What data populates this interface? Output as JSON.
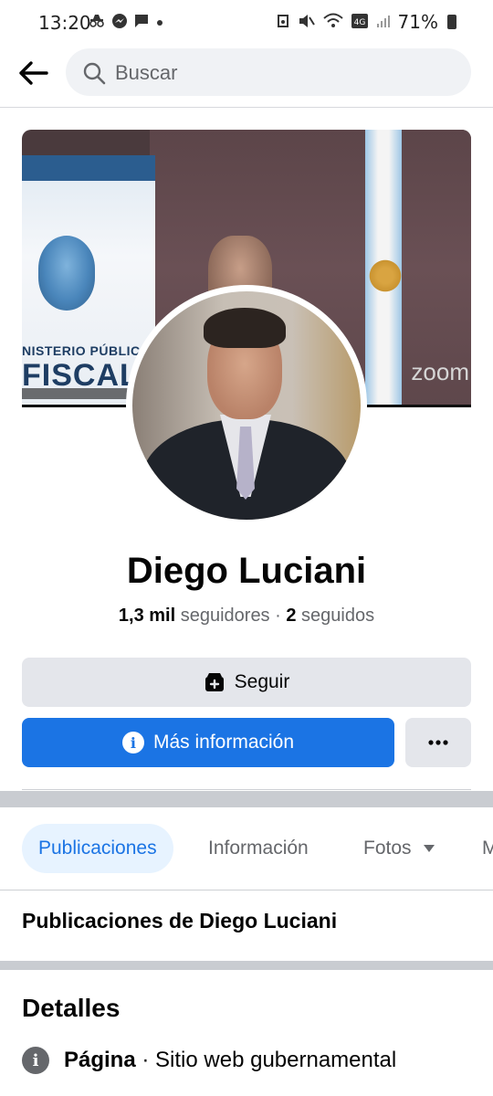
{
  "status_bar": {
    "time": "13:20",
    "battery": "71%",
    "left_icons": [
      "incognito-icon",
      "messenger-icon",
      "chat-icon",
      "dot-icon"
    ],
    "right_icons": [
      "alarm-icon",
      "mute-icon",
      "wifi-icon",
      "volte-4g-icon",
      "signal-icon",
      "battery-icon"
    ]
  },
  "search": {
    "placeholder": "Buscar"
  },
  "cover": {
    "banner_line1": "NISTERIO PÚBLICO",
    "banner_line2": "FISCAL",
    "zoom_text": "zoom"
  },
  "profile": {
    "name": "Diego Luciani",
    "followers_count": "1,3 mil",
    "followers_label": "seguidores",
    "separator": "·",
    "following_count": "2",
    "following_label": "seguidos"
  },
  "actions": {
    "follow_label": "Seguir",
    "info_label": "Más información",
    "more_label": "•••"
  },
  "tabs": [
    {
      "label": "Publicaciones",
      "active": true
    },
    {
      "label": "Información",
      "active": false
    },
    {
      "label": "Fotos",
      "active": false
    },
    {
      "label": "M",
      "active": false
    }
  ],
  "posts_section": {
    "heading": "Publicaciones de Diego Luciani"
  },
  "details": {
    "heading": "Detalles",
    "rows": [
      {
        "type": "Página",
        "separator": "·",
        "value": "Sitio web gubernamental"
      }
    ]
  },
  "colors": {
    "primary": "#1b74e4",
    "button_gray": "#e4e6eb",
    "tab_active_bg": "#e7f3ff",
    "secondary_text": "#65676b"
  }
}
